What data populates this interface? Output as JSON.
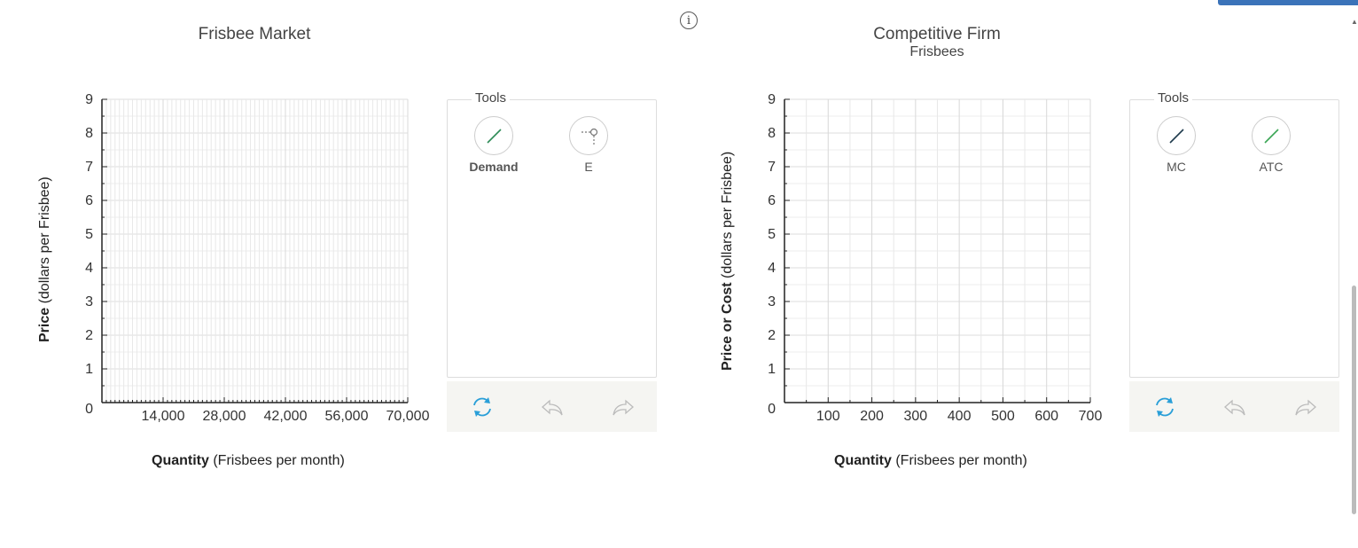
{
  "left_panel": {
    "title": "Frisbee Market",
    "y_ticks": [
      "0",
      "1",
      "2",
      "3",
      "4",
      "5",
      "6",
      "7",
      "8",
      "9"
    ],
    "x_ticks": [
      "14,000",
      "28,000",
      "42,000",
      "56,000",
      "70,000"
    ],
    "x_label_bold": "Quantity",
    "x_label_rest": " (Frisbees per month)",
    "y_label_bold": "Price",
    "y_label_rest": " (dollars per Frisbee)",
    "tools_title": "Tools",
    "tools": [
      {
        "label": "Demand",
        "icon": "line-tool-icon",
        "color": "#2e8b57"
      },
      {
        "label": "E",
        "icon": "equilibrium-point-icon",
        "color": "#666666"
      }
    ]
  },
  "right_panel": {
    "title": "Competitive Firm",
    "subtitle": "Frisbees",
    "y_ticks": [
      "0",
      "1",
      "2",
      "3",
      "4",
      "5",
      "6",
      "7",
      "8",
      "9"
    ],
    "x_ticks": [
      "100",
      "200",
      "300",
      "400",
      "500",
      "600",
      "700"
    ],
    "x_label_bold": "Quantity",
    "x_label_rest": " (Frisbees per month)",
    "y_label_bold": "Price or Cost",
    "y_label_rest": " (dollars per Frisbee)",
    "tools_title": "Tools",
    "tools": [
      {
        "label": "MC",
        "icon": "line-tool-icon",
        "color": "#1f3a4d"
      },
      {
        "label": "ATC",
        "icon": "line-tool-icon",
        "color": "#3aa655"
      }
    ]
  },
  "info_button": "i",
  "colors": {
    "accent": "#3b73b9",
    "refresh": "#2a9fd8",
    "disabled": "#bbbbbb"
  }
}
